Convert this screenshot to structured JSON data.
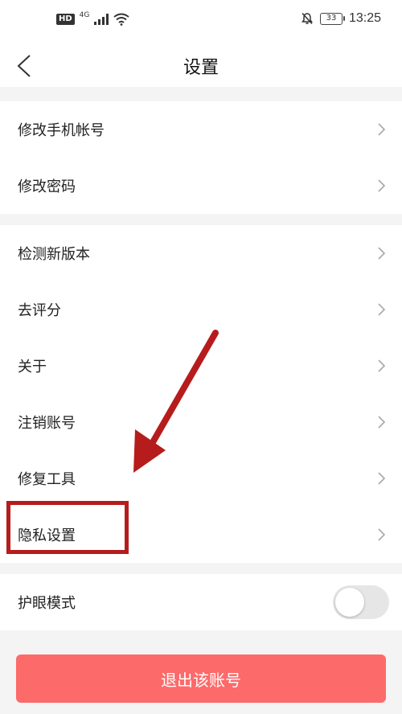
{
  "status_bar": {
    "hd_badge": "HD",
    "network": "4G",
    "battery": "33",
    "time": "13:25"
  },
  "header": {
    "title": "设置",
    "back_icon": "chevron-left-icon"
  },
  "group_account": {
    "items": [
      {
        "label": "修改手机帐号"
      },
      {
        "label": "修改密码"
      }
    ]
  },
  "group_general": {
    "items": [
      {
        "label": "检测新版本"
      },
      {
        "label": "去评分"
      },
      {
        "label": "关于"
      },
      {
        "label": "注销账号"
      },
      {
        "label": "修复工具"
      },
      {
        "label": "隐私设置"
      }
    ]
  },
  "eye_mode": {
    "label": "护眼模式",
    "enabled": false
  },
  "logout": {
    "label": "退出该账号"
  },
  "annotation": {
    "box_color": "#b61c1c",
    "arrow_color": "#b61c1c"
  },
  "colors": {
    "accent": "#fd6a6a",
    "background": "#f4f4f4"
  }
}
